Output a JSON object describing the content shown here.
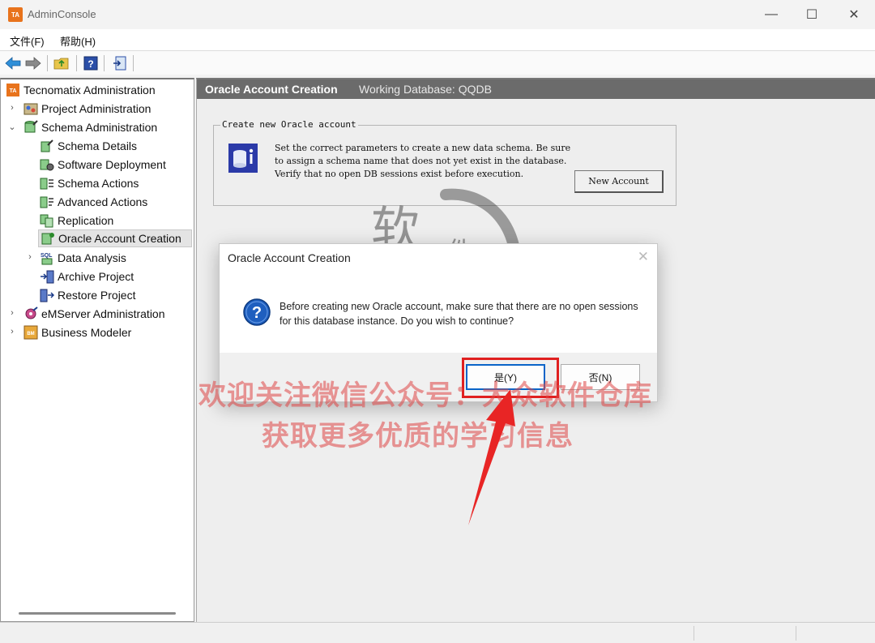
{
  "window": {
    "icon_text": "TA",
    "title": "AdminConsole",
    "minimize": "—",
    "maximize": "☐",
    "close": "✕"
  },
  "menu": [
    "文件(F)",
    "帮助(H)"
  ],
  "toolbar": {
    "buttons": [
      "back-icon",
      "forward-icon",
      "folder-up-icon",
      "help-icon",
      "exit-icon"
    ]
  },
  "tree": {
    "root": "Tecnomatix Administration",
    "items": [
      {
        "label": "Project Administration",
        "icon": "project-icon"
      },
      {
        "label": "Schema Administration",
        "icon": "schema-icon"
      },
      {
        "label": "Schema Details",
        "icon": "schema-details-icon"
      },
      {
        "label": "Software Deployment",
        "icon": "software-deployment-icon"
      },
      {
        "label": "Schema Actions",
        "icon": "schema-actions-icon"
      },
      {
        "label": "Advanced Actions",
        "icon": "advanced-actions-icon"
      },
      {
        "label": "Replication",
        "icon": "replication-icon"
      },
      {
        "label": "Oracle Account Creation",
        "icon": "oracle-account-icon"
      },
      {
        "label": "Data Analysis",
        "icon": "sql-icon"
      },
      {
        "label": "Archive Project",
        "icon": "archive-icon"
      },
      {
        "label": "Restore Project",
        "icon": "restore-icon"
      },
      {
        "label": "eMServer Administration",
        "icon": "emserver-icon"
      },
      {
        "label": "Business Modeler",
        "icon": "business-modeler-icon"
      }
    ]
  },
  "main": {
    "title": "Oracle Account Creation",
    "working_db": "Working Database: QQDB",
    "group_title": "Create new Oracle account",
    "description": "Set the correct parameters to create a new data schema. Be sure to assign a schema name that does not yet exist in the database. Verify that no open DB sessions exist before execution.",
    "new_account_label": "New Account"
  },
  "dialog": {
    "title": "Oracle Account Creation",
    "close": "✕",
    "message": "Before creating new Oracle account, make sure that there are no open sessions for this database instance. Do you wish to continue?",
    "yes_label": "是(Y)",
    "no_label": "否(N)"
  },
  "watermark": {
    "seal_char_1": "软",
    "seal_char_2": "件",
    "line1": "欢迎关注微信公众号：大众软件仓库",
    "line2": "获取更多优质的学习信息"
  },
  "colors": {
    "header_bg": "#6b6b6b",
    "accent_orange": "#e8731c",
    "default_button_border": "#0a64c8",
    "highlight_red": "#e02020",
    "watermark_red": "#de4646"
  }
}
